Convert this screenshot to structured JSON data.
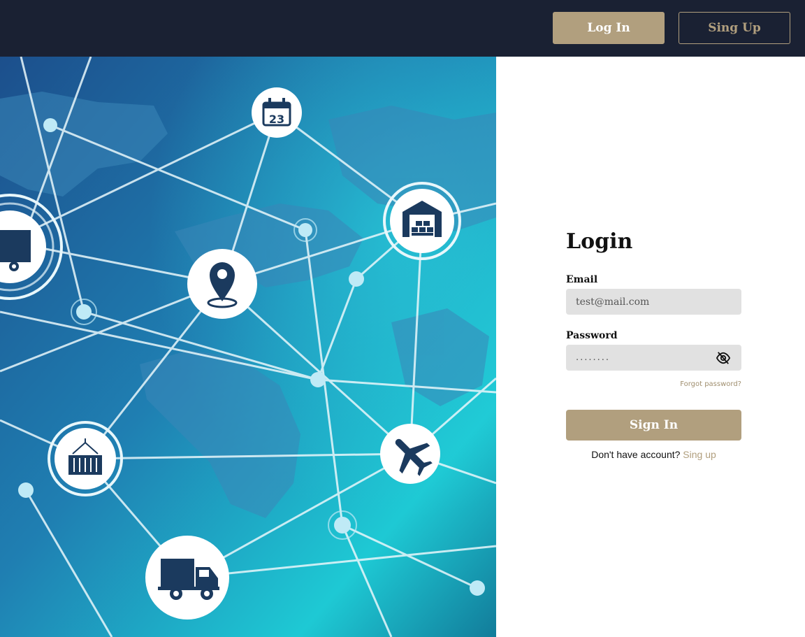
{
  "header": {
    "login_label": "Log In",
    "signup_label": "Sing Up"
  },
  "hero": {
    "calendar_day": "23"
  },
  "form": {
    "title": "Login",
    "email_label": "Email",
    "email_value": "test@mail.com",
    "password_label": "Password",
    "password_value": "........",
    "forgot_label": "Forgot password?",
    "submit_label": "Sign In",
    "footer_text": "Don't have account?",
    "footer_link": "Sing up"
  },
  "colors": {
    "header_bg": "#1a2133",
    "accent": "#b19f7e",
    "field_bg": "#e1e1e1"
  }
}
